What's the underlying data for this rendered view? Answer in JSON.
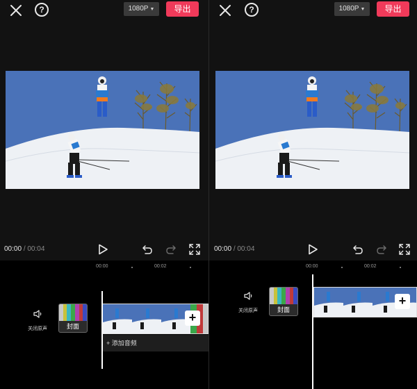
{
  "screens": [
    {
      "resolution": "1080P",
      "export_label": "导出",
      "time_current": "00:00",
      "time_separator": "/",
      "time_total": "00:04",
      "ruler": [
        "00:00",
        "00:02"
      ],
      "mute_label": "关闭原声",
      "cover_label": "封面",
      "add_audio_label": "添加音频"
    },
    {
      "resolution": "1080P",
      "export_label": "导出",
      "time_current": "00:00",
      "time_separator": "/",
      "time_total": "00:04",
      "ruler": [
        "00:00",
        "00:02"
      ],
      "mute_label": "关闭原声",
      "cover_label": "封面"
    }
  ],
  "icons": {
    "close": "close-icon",
    "help": "help-icon",
    "caret": "caret-down-icon",
    "play": "play-icon",
    "undo": "undo-icon",
    "redo": "redo-icon",
    "fullscreen": "fullscreen-icon",
    "mute": "speaker-icon",
    "add": "plus-icon"
  },
  "colors": {
    "accent": "#f03a5a",
    "sky": "#4a72b8",
    "snow": "#eef1f5",
    "background": "#121212"
  }
}
